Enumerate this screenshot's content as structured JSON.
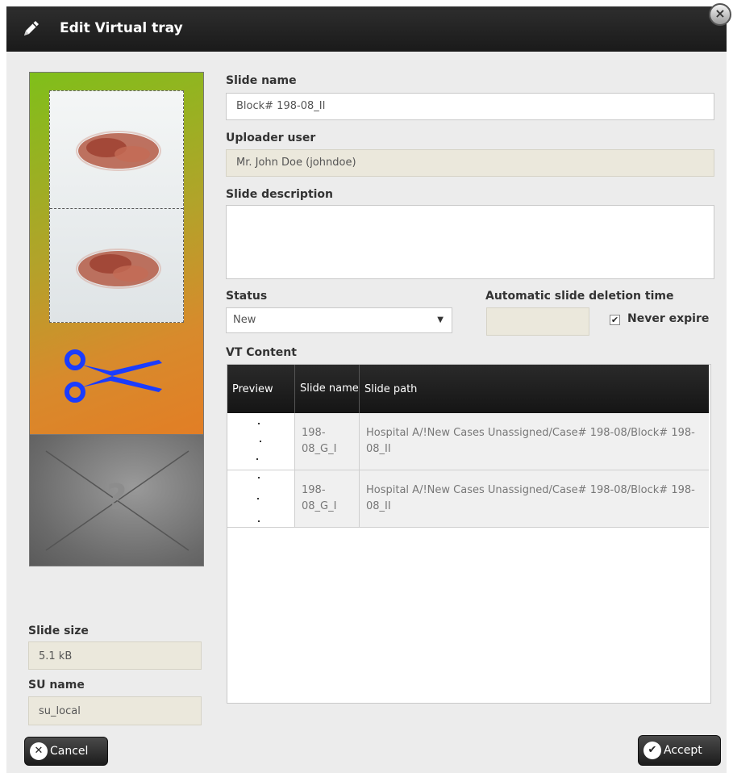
{
  "dialog": {
    "title": "Edit Virtual tray",
    "close_label": "×"
  },
  "form": {
    "slide_name_label": "Slide name",
    "slide_name_value": "Block# 198-08_II",
    "uploader_label": "Uploader user",
    "uploader_value": "Mr. John Doe (johndoe)",
    "description_label": "Slide description",
    "description_value": "",
    "status_label": "Status",
    "status_value": "New",
    "deletion_label": "Automatic slide deletion time",
    "deletion_value": "",
    "never_expire_label": "Never expire",
    "never_expire_checked": true
  },
  "thumbnail": {
    "unknown_glyph": "?"
  },
  "side_info": {
    "slide_size_label": "Slide size",
    "slide_size_value": "5.1 kB",
    "su_name_label": "SU name",
    "su_name_value": "su_local"
  },
  "vt_content": {
    "label": "VT Content",
    "columns": [
      "Preview",
      "Slide name",
      "Slide path"
    ],
    "rows": [
      {
        "slide_name": "198-08_G_I",
        "slide_path": "Hospital A/!New Cases Unassigned/Case# 198-08/Block# 198-08_II"
      },
      {
        "slide_name": "198-08_G_I",
        "slide_path": "Hospital A/!New Cases Unassigned/Case# 198-08/Block# 198-08_II"
      }
    ]
  },
  "buttons": {
    "cancel_label": "Cancel",
    "accept_label": "Accept"
  },
  "colors": {
    "title_bar": "#1f1f1f",
    "scissors": "#1a3cff",
    "readonly_field": "#ebe8dc"
  }
}
